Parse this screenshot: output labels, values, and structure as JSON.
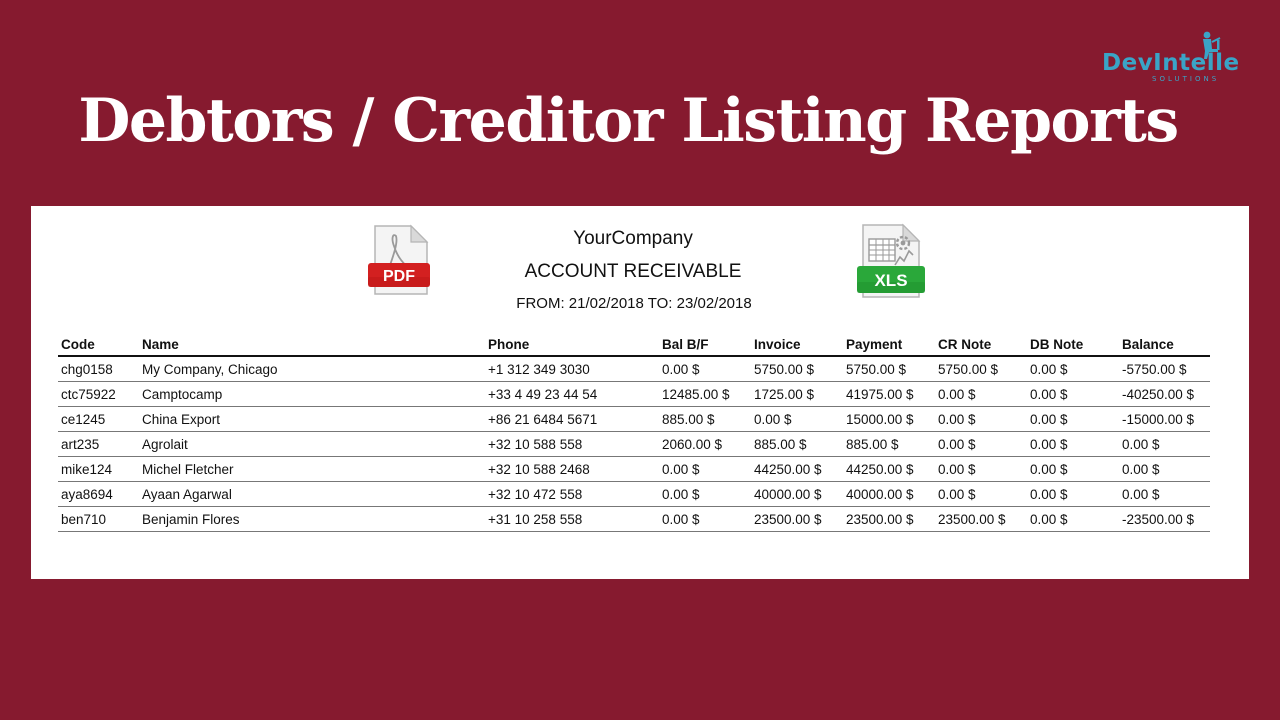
{
  "logo": {
    "text": "DevIntelle",
    "subtext": "SOLUTIONS"
  },
  "page_title": "Debtors / Creditor Listing Reports",
  "report": {
    "company": "YourCompany",
    "title": "ACCOUNT RECEIVABLE",
    "period": "FROM: 21/02/2018 TO: 23/02/2018",
    "pdf_label": "PDF",
    "xls_label": "XLS",
    "columns": [
      "Code",
      "Name",
      "Phone",
      "Bal B/F",
      "Invoice",
      "Payment",
      "CR Note",
      "DB Note",
      "Balance"
    ],
    "rows": [
      [
        "chg0158",
        "My Company, Chicago",
        "+1 312 349 3030",
        "0.00 $",
        "5750.00 $",
        "5750.00 $",
        "5750.00 $",
        "0.00 $",
        "-5750.00 $"
      ],
      [
        "ctc75922",
        "Camptocamp",
        "+33 4 49 23 44 54",
        "12485.00 $",
        "1725.00 $",
        "41975.00 $",
        "0.00 $",
        "0.00 $",
        "-40250.00 $"
      ],
      [
        "ce1245",
        "China Export",
        "+86 21 6484 5671",
        "885.00 $",
        "0.00 $",
        "15000.00 $",
        "0.00 $",
        "0.00 $",
        "-15000.00 $"
      ],
      [
        "art235",
        "Agrolait",
        "+32 10 588 558",
        "2060.00 $",
        "885.00 $",
        "885.00 $",
        "0.00 $",
        "0.00 $",
        "0.00 $"
      ],
      [
        "mike124",
        "Michel Fletcher",
        "+32 10 588 2468",
        "0.00 $",
        "44250.00 $",
        "44250.00 $",
        "0.00 $",
        "0.00 $",
        "0.00 $"
      ],
      [
        "aya8694",
        "Ayaan Agarwal",
        "+32 10 472 558",
        "0.00 $",
        "40000.00 $",
        "40000.00 $",
        "0.00 $",
        "0.00 $",
        "0.00 $"
      ],
      [
        "ben710",
        "Benjamin Flores",
        "+31 10 258 558",
        "0.00 $",
        "23500.00 $",
        "23500.00 $",
        "23500.00 $",
        "0.00 $",
        "-23500.00 $"
      ]
    ]
  },
  "colors": {
    "background": "#861a2f",
    "logo": "#3aa4c7",
    "pdf_badge": "#d32020",
    "xls_badge": "#2aa83a"
  }
}
